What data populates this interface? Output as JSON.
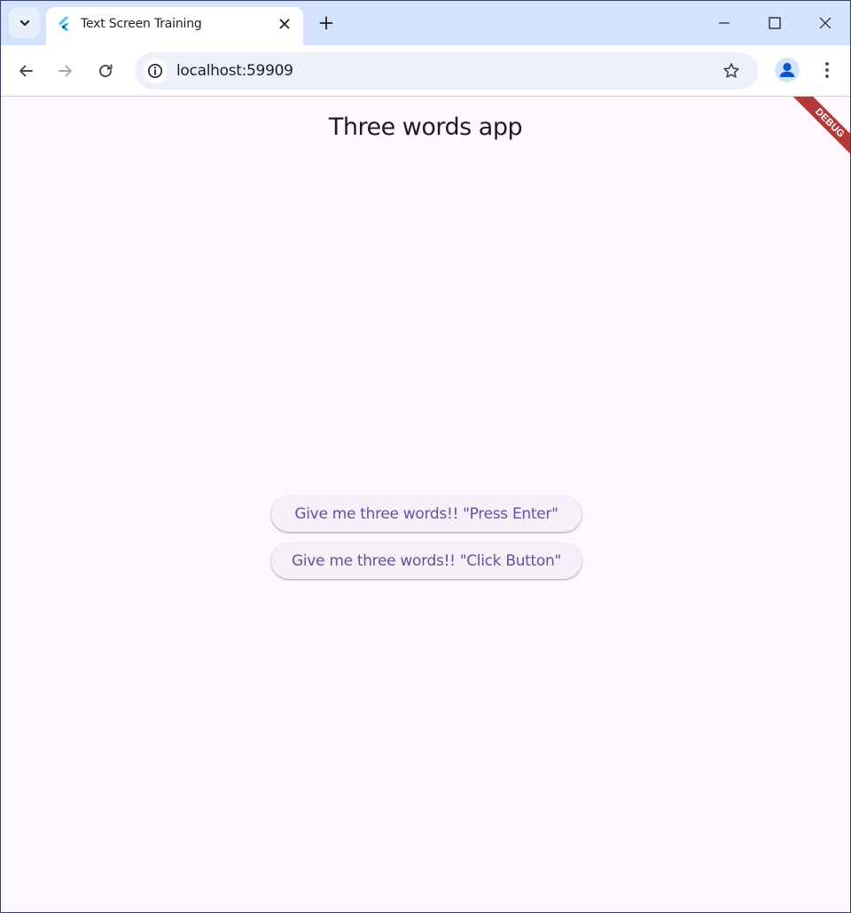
{
  "browser": {
    "tab_title": "Text Screen Training",
    "url": "localhost:59909",
    "icons": {
      "tab_search": "chevron-down-icon",
      "favicon": "flutter-icon",
      "tab_close": "close-icon",
      "new_tab": "plus-icon",
      "minimize": "minimize-icon",
      "maximize": "maximize-icon",
      "window_close": "close-icon",
      "back": "back-arrow-icon",
      "forward": "forward-arrow-icon",
      "reload": "reload-icon",
      "site_info": "info-icon",
      "bookmark": "star-icon",
      "profile": "person-icon",
      "menu": "kebab-menu-icon"
    }
  },
  "app": {
    "title": "Three words app",
    "debug_label": "DEBUG",
    "buttons": [
      {
        "label": "Give me three words!! \"Press Enter\""
      },
      {
        "label": "Give me three words!! \"Click Button\""
      }
    ]
  },
  "colors": {
    "tabstrip": "#d3e3fd",
    "page_bg": "#fdf7fe",
    "button_text": "#67509b",
    "debug_banner": "#b13b3b"
  }
}
